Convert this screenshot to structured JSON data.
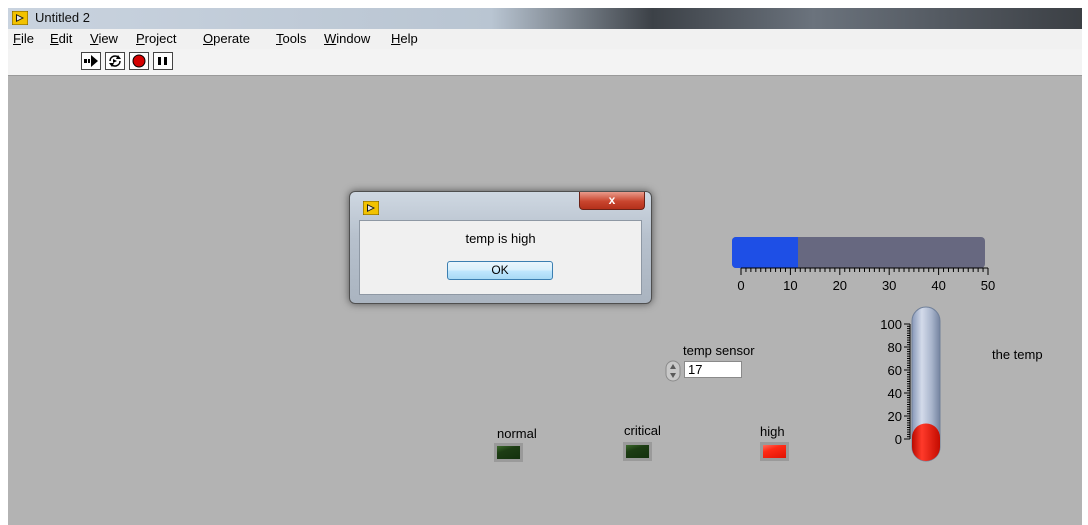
{
  "window": {
    "title": "Untitled 2"
  },
  "menu": [
    {
      "label": "File",
      "mnemonic": "F",
      "rest": "ile"
    },
    {
      "label": "Edit",
      "mnemonic": "E",
      "rest": "dit"
    },
    {
      "label": "View",
      "mnemonic": "V",
      "rest": "iew"
    },
    {
      "label": "Project",
      "mnemonic": "P",
      "rest": "roject"
    },
    {
      "label": "Operate",
      "mnemonic": "O",
      "rest": "perate"
    },
    {
      "label": "Tools",
      "mnemonic": "T",
      "rest": "ools"
    },
    {
      "label": "Window",
      "mnemonic": "W",
      "rest": "indow"
    },
    {
      "label": "Help",
      "mnemonic": "H",
      "rest": "elp"
    }
  ],
  "toolbar": {
    "buttons": [
      "run-arrow-icon",
      "run-continuously-icon",
      "abort-execution-icon",
      "pause-icon"
    ]
  },
  "dialog": {
    "message": "temp is high",
    "ok_label": "OK",
    "close_symbol": "x"
  },
  "progress": {
    "value": 13,
    "min": 0,
    "max": 50,
    "tick_labels": [
      "0",
      "10",
      "20",
      "30",
      "40",
      "50"
    ],
    "fill_color": "#1e4fe6",
    "track_color": "#676880"
  },
  "temp_sensor": {
    "label": "temp sensor",
    "value": "17"
  },
  "indicators": [
    {
      "label": "normal",
      "state": "off"
    },
    {
      "label": "critical",
      "state": "off"
    },
    {
      "label": "high",
      "state": "on"
    }
  ],
  "thermometer": {
    "label": "the temp",
    "value": 17,
    "min": 0,
    "max": 100,
    "tick_labels": [
      "100",
      "80",
      "60",
      "40",
      "20",
      "0"
    ],
    "fill_color": "#e81b10"
  },
  "colors": {
    "panel_bg": "#b3b3b3",
    "led_on": "#ff2a15",
    "led_off": "#1d3d14"
  }
}
